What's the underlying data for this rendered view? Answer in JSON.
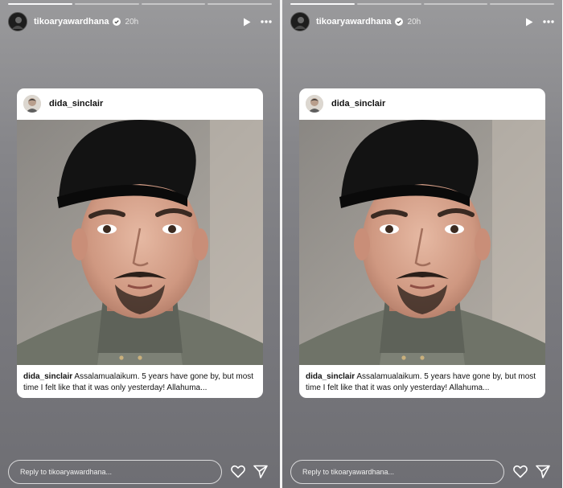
{
  "stories": [
    {
      "username": "tikoaryawardhana",
      "time": "20h",
      "post_user": "dida_sinclair",
      "caption": "Assalamualaikum. 5 years have gone by, but most time I felt like that it was only yesterday! Allahuma...",
      "reply_placeholder": "Reply to tikoaryawardhana..."
    },
    {
      "username": "tikoaryawardhana",
      "time": "20h",
      "post_user": "dida_sinclair",
      "caption": "Assalamualaikum. 5 years have gone by, but most time I felt like that it was only yesterday! Allahuma...",
      "reply_placeholder": "Reply to tikoaryawardhana..."
    }
  ],
  "icons": [
    "verified-badge-icon",
    "play-icon",
    "more-options-icon",
    "heart-icon",
    "send-icon"
  ],
  "colors": {
    "story_bg": "#86868a",
    "card_bg": "#ffffff",
    "text_dark": "#111111"
  }
}
